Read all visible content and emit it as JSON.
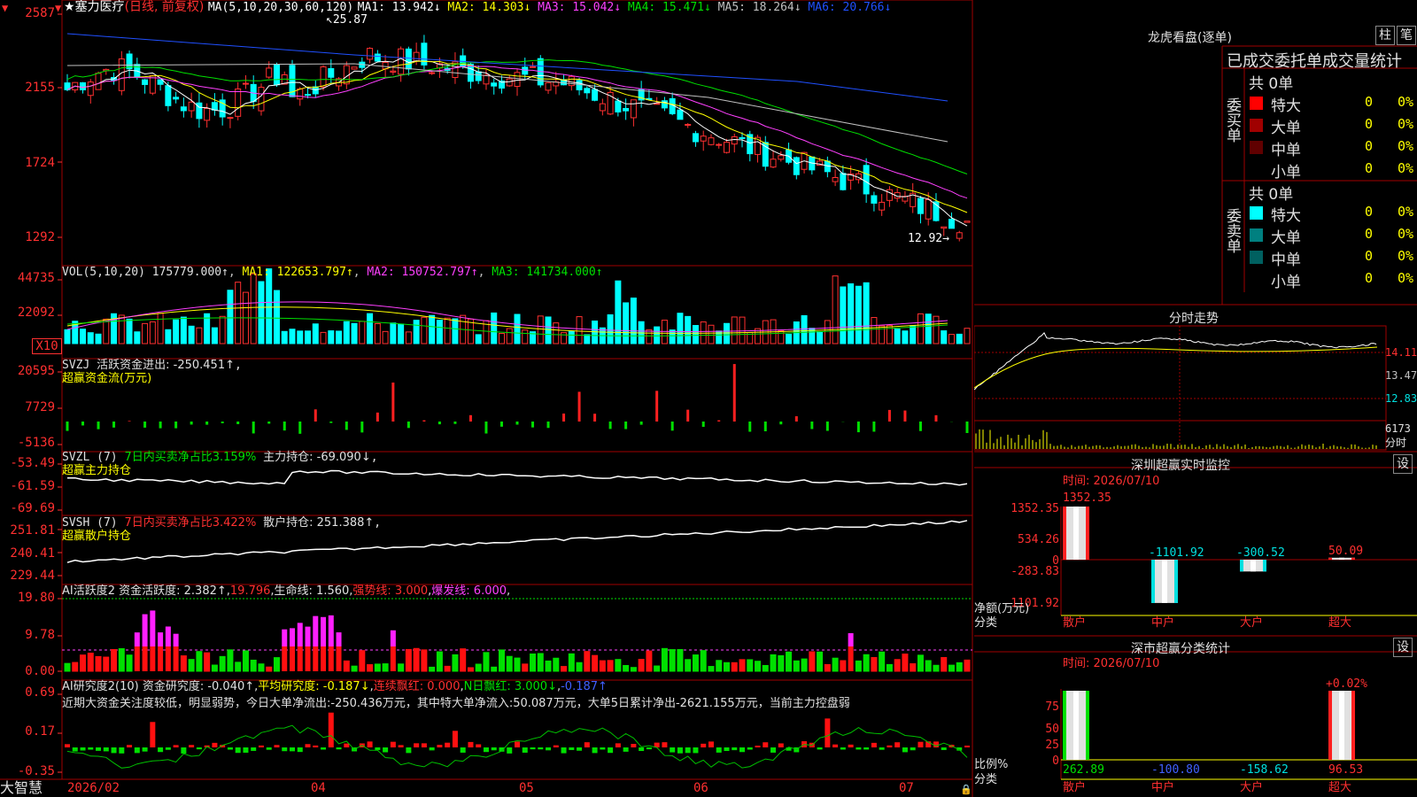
{
  "app": {
    "brand": "大智慧"
  },
  "main": {
    "stock_star": "★",
    "stock_name": "塞力医疗",
    "period_mode": "(日线, 前复权)",
    "ma_params": "MA(5,10,20,30,60,120)",
    "ma_values": [
      {
        "label": "MA1: 13.942↓",
        "color": "#ffffff"
      },
      {
        "label": "MA2: 14.303↓",
        "color": "#ffff00"
      },
      {
        "label": "MA3: 15.042↓",
        "color": "#ff40ff"
      },
      {
        "label": "MA4: 15.471↓",
        "color": "#00e000"
      },
      {
        "label": "MA5: 18.264↓",
        "color": "#c0c0c0"
      },
      {
        "label": "MA6: 20.766↓",
        "color": "#2050ff"
      }
    ],
    "high_mark": "25.87",
    "low_mark": "12.92→",
    "y_labels": [
      "2587",
      "2155",
      "1724",
      "1292"
    ],
    "x_labels": [
      "2026/02",
      "04",
      "05",
      "06",
      "07"
    ]
  },
  "vol": {
    "title": "VOL(5,10,20)",
    "value": "175779.000↑",
    "ma1": "MA1: 122653.797↑",
    "ma2": "MA2: 150752.797↑",
    "ma3": "MA3: 141734.000↑",
    "y_labels": [
      "44735",
      "22092"
    ],
    "unit": "X10"
  },
  "svzj": {
    "title": "SVZJ",
    "label": "活跃资金进出: -250.451↑",
    "sub": "超赢资金流(万元)",
    "y_labels": [
      "20595",
      "7729",
      "-5136"
    ]
  },
  "svzl": {
    "title": "SVZL (7)",
    "pct": "7日内买卖净占比3.159%",
    "hold": "主力持仓: -69.090↓",
    "sub": "超赢主力持仓",
    "y_labels": [
      "-53.49",
      "-61.59",
      "-69.69"
    ]
  },
  "svsh": {
    "title": "SVSH (7)",
    "pct": "7日内买卖净占比3.422%",
    "hold": "散户持仓: 251.388↑",
    "sub": "超赢散户持仓",
    "y_labels": [
      "251.81",
      "240.41",
      "229.44"
    ]
  },
  "aihy": {
    "title": "AI活跃度2",
    "a": "资金活跃度: 2.382↑",
    "b": "19.796",
    "c": "生命线: 1.560",
    "d": "强势线: 3.000",
    "e": "爆发线: 6.000",
    "y_labels": [
      "19.80",
      "9.78",
      "0.00"
    ]
  },
  "aiyj": {
    "title": "AI研究度2(10)",
    "a": "资金研究度: -0.040↑",
    "b": "平均研究度: -0.187↓",
    "c": "连续飘红: 0.000",
    "d": "N日飘红: 3.000↓",
    "e": "-0.187↑",
    "note": "近期大资金关注度较低，明显弱势，今日大单净流出:-250.436万元，其中特大单净流入:50.087万元，大单5日累计净出-2621.155万元，当前主力控盘弱",
    "y_labels": [
      "0.69",
      "0.17",
      "-0.35"
    ]
  },
  "lhb": {
    "title": "龙虎看盘(逐单)",
    "btn_bar": "柱",
    "btn_pen": "笔",
    "header": "已成交委托单成交量统计",
    "buy_label": "委买单",
    "sell_label": "委卖单",
    "buy_total": "共 0单",
    "sell_total": "共 0单",
    "buy_rows": [
      {
        "name": "特大",
        "count": "0",
        "pct": "0%",
        "color": "#ff0000"
      },
      {
        "name": "大单",
        "count": "0",
        "pct": "0%",
        "color": "#a00000"
      },
      {
        "name": "中单",
        "count": "0",
        "pct": "0%",
        "color": "#600000"
      },
      {
        "name": "小单",
        "count": "0",
        "pct": "0%",
        "color": ""
      }
    ],
    "sell_rows": [
      {
        "name": "特大",
        "count": "0",
        "pct": "0%",
        "color": "#00ffff"
      },
      {
        "name": "大单",
        "count": "0",
        "pct": "0%",
        "color": "#008080"
      },
      {
        "name": "中单",
        "count": "0",
        "pct": "0%",
        "color": "#006060"
      },
      {
        "name": "小单",
        "count": "0",
        "pct": "0%",
        "color": ""
      }
    ]
  },
  "fenshi": {
    "title": "分时走势",
    "prices": [
      "14.11",
      "13.47",
      "12.83"
    ],
    "vol": "6173",
    "vol_unit": "分时"
  },
  "monitor": {
    "title": "深圳超赢实时监控",
    "btn": "设",
    "time": "时间: 2026/07/10",
    "y_labels": [
      "1352.35",
      "534.26",
      "0",
      "-283.83",
      "-1101.92"
    ],
    "unit1": "净额(万元)",
    "unit2": "分类",
    "categories": [
      "散户",
      "中户",
      "大户",
      "超大"
    ],
    "values": [
      1352.35,
      -1101.92,
      -300.52,
      50.09
    ],
    "value_labels": [
      "1352.35",
      "-1101.92",
      "-300.52",
      "50.09"
    ]
  },
  "classify": {
    "title": "深市超赢分类统计",
    "btn": "设",
    "time": "时间: 2026/07/10",
    "y_labels": [
      "75",
      "50",
      "25",
      "0"
    ],
    "unit1": "比例%",
    "unit2": "分类",
    "top_label": "+0.02%",
    "categories": [
      "散户",
      "中户",
      "大户",
      "超大"
    ],
    "bar_values": [
      100,
      0,
      0,
      100
    ],
    "value_labels": [
      "262.89",
      "-100.80",
      "-158.62",
      "96.53"
    ]
  }
}
